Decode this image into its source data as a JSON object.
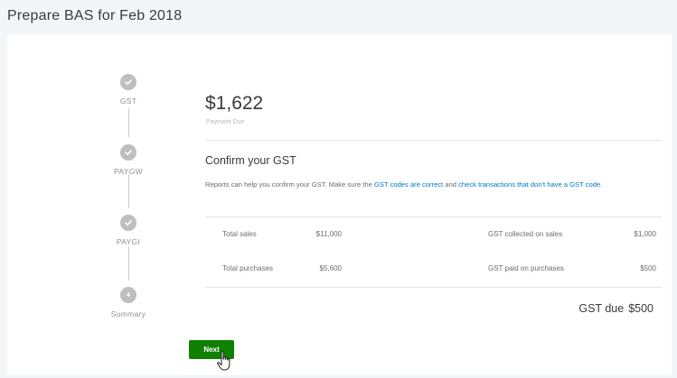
{
  "page": {
    "title": "Prepare BAS for Feb 2018"
  },
  "steps": [
    {
      "label": "GST",
      "state": "complete",
      "icon": "check-icon"
    },
    {
      "label": "PAYGW",
      "state": "complete",
      "icon": "check-icon"
    },
    {
      "label": "PAYGI",
      "state": "complete",
      "icon": "check-icon"
    },
    {
      "label": "Summary",
      "state": "current",
      "number": "4"
    }
  ],
  "payment": {
    "amount": "$1,622",
    "caption": "Payment Due"
  },
  "confirm": {
    "title": "Confirm your GST",
    "desc_prefix": "Reports can help you confirm your GST. Make sure the ",
    "link_codes": "GST codes are correct",
    "desc_mid": " and ",
    "link_transactions": "check transactions that don't have a GST code",
    "desc_suffix": "."
  },
  "summary_rows": [
    {
      "label": "Total sales",
      "value": "$11,000",
      "gst_label": "GST collected on sales",
      "gst_value": "$1,000"
    },
    {
      "label": "Total purchases",
      "value": "$5,600",
      "gst_label": "GST paid on purchases",
      "gst_value": "$500"
    }
  ],
  "gst_due": {
    "label": "GST due",
    "value": "$500"
  },
  "actions": {
    "next_label": "Next"
  },
  "colors": {
    "primary_button": "#108000",
    "link": "#0077c5",
    "step_dot": "#bdbec2"
  }
}
